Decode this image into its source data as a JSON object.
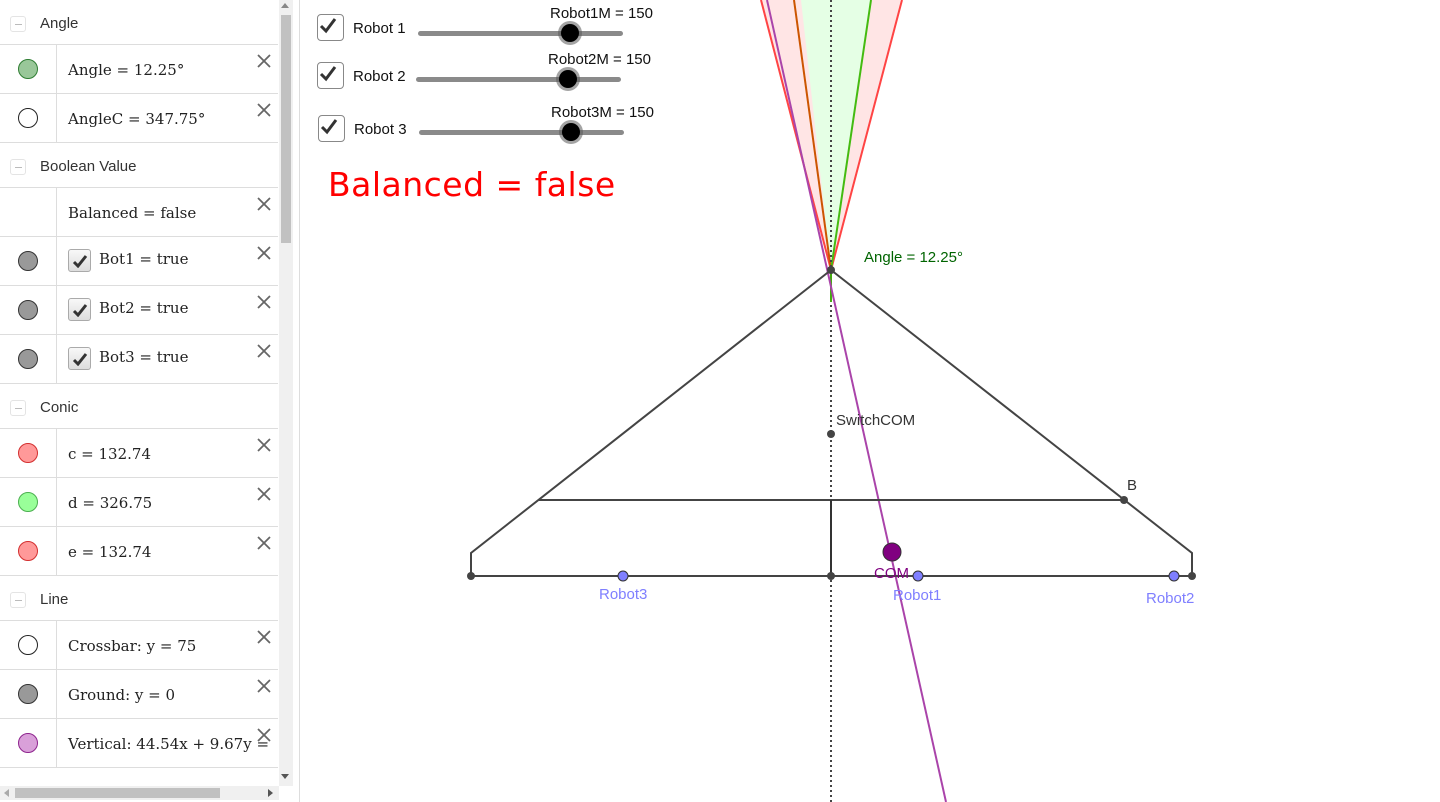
{
  "algebra": {
    "groups": [
      {
        "title": "Angle",
        "rows": [
          {
            "text": "Angle = 12.25°",
            "marble": "#99c799",
            "marble_border": "#2e7d32"
          },
          {
            "text": "AngleC = 347.75°",
            "marble": "#ffffff",
            "marble_border": "#222222"
          }
        ]
      },
      {
        "title": "Boolean Value",
        "rows": [
          {
            "text": "Balanced = false",
            "marble": null
          },
          {
            "text": "Bot1 = true",
            "marble": "#999999",
            "marble_border": "#333333",
            "checkbox": true
          },
          {
            "text": "Bot2 = true",
            "marble": "#999999",
            "marble_border": "#333333",
            "checkbox": true
          },
          {
            "text": "Bot3 = true",
            "marble": "#999999",
            "marble_border": "#333333",
            "checkbox": true
          }
        ]
      },
      {
        "title": "Conic",
        "rows": [
          {
            "text": "c = 132.74",
            "marble": "#ff9999",
            "marble_border": "#d32f2f"
          },
          {
            "text": "d = 326.75",
            "marble": "#99ff99",
            "marble_border": "#4caf50"
          },
          {
            "text": "e = 132.74",
            "marble": "#ff9999",
            "marble_border": "#d32f2f"
          }
        ]
      },
      {
        "title": "Line",
        "rows": [
          {
            "text": "Crossbar: y = 75",
            "marble": "#ffffff",
            "marble_border": "#222222"
          },
          {
            "text": "Ground: y = 0",
            "marble": "#999999",
            "marble_border": "#333333"
          },
          {
            "text": "Vertical: 44.54x + 9.67y =",
            "marble": "#d9a0d9",
            "marble_border": "#8e248e"
          }
        ]
      }
    ],
    "delete_icon": "close-icon"
  },
  "graphics": {
    "robots": [
      {
        "label": "Robot 1",
        "checked": true,
        "slider_label": "Robot1M = 150",
        "value": 150,
        "fraction": 0.74
      },
      {
        "label": "Robot 2",
        "checked": true,
        "slider_label": "Robot2M = 150",
        "value": 150,
        "fraction": 0.74
      },
      {
        "label": "Robot 3",
        "checked": true,
        "slider_label": "Robot3M = 150",
        "value": 150,
        "fraction": 0.74
      }
    ],
    "balanced_text": "Balanced = false",
    "angle_label": "Angle = 12.25°",
    "point_labels": {
      "switchcom": "SwitchCOM",
      "b": "B",
      "com": "COM",
      "robot1": "Robot1",
      "robot2": "Robot2",
      "robot3": "Robot3"
    },
    "colors": {
      "red": "#ff4444",
      "green": "#44bb11",
      "purple": "#aa44aa",
      "orange": "#cc5500",
      "angle_text": "#006400",
      "com": "#800080",
      "robot_points": "#7f7fff",
      "robot_labels": "#7f7fff",
      "balanced_text": "#ff0000"
    }
  }
}
